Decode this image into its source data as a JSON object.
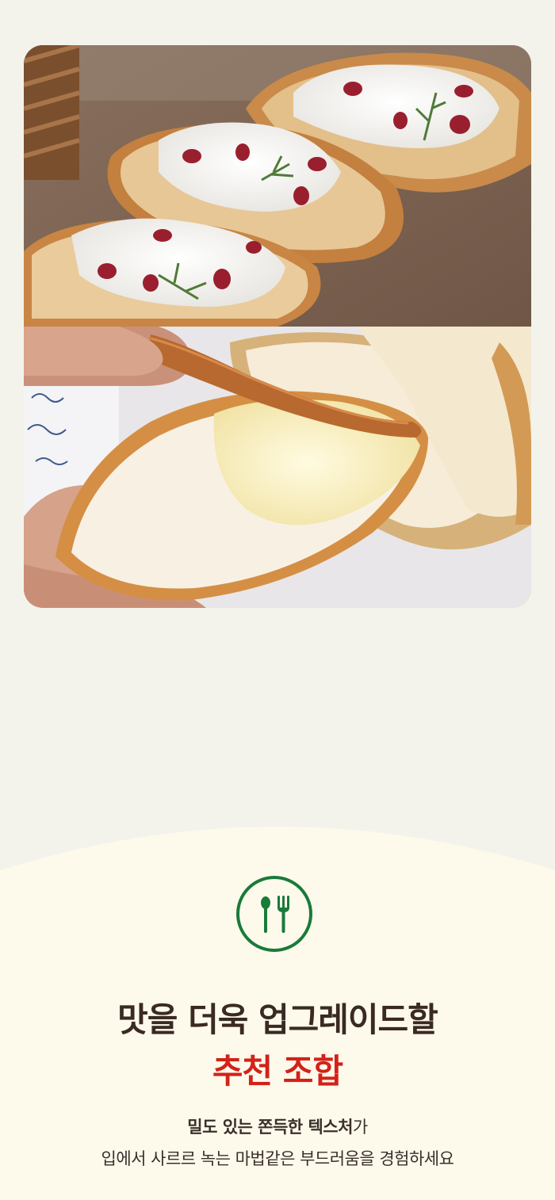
{
  "photos": [
    {
      "name": "crostini-with-cream-cheese-and-cranberry"
    },
    {
      "name": "spreading-cream-on-baguette"
    }
  ],
  "icon": {
    "name": "utensils-icon",
    "color": "#1a7a3a"
  },
  "headline": {
    "line1": "맛을 더욱 업그레이드할",
    "line2": "추천 조합"
  },
  "description": {
    "line1_bold": "밀도 있는 쫀득한 텍스처",
    "line1_rest": "가",
    "line2": "입에서 사르르 녹는 마법같은 부드러움을 경험하세요"
  },
  "colors": {
    "page_bg": "#f3f3ec",
    "bottom_bg": "#fdfaec",
    "headline": "#3a2a22",
    "accent_red": "#d32219",
    "icon_green": "#1a7a3a"
  }
}
